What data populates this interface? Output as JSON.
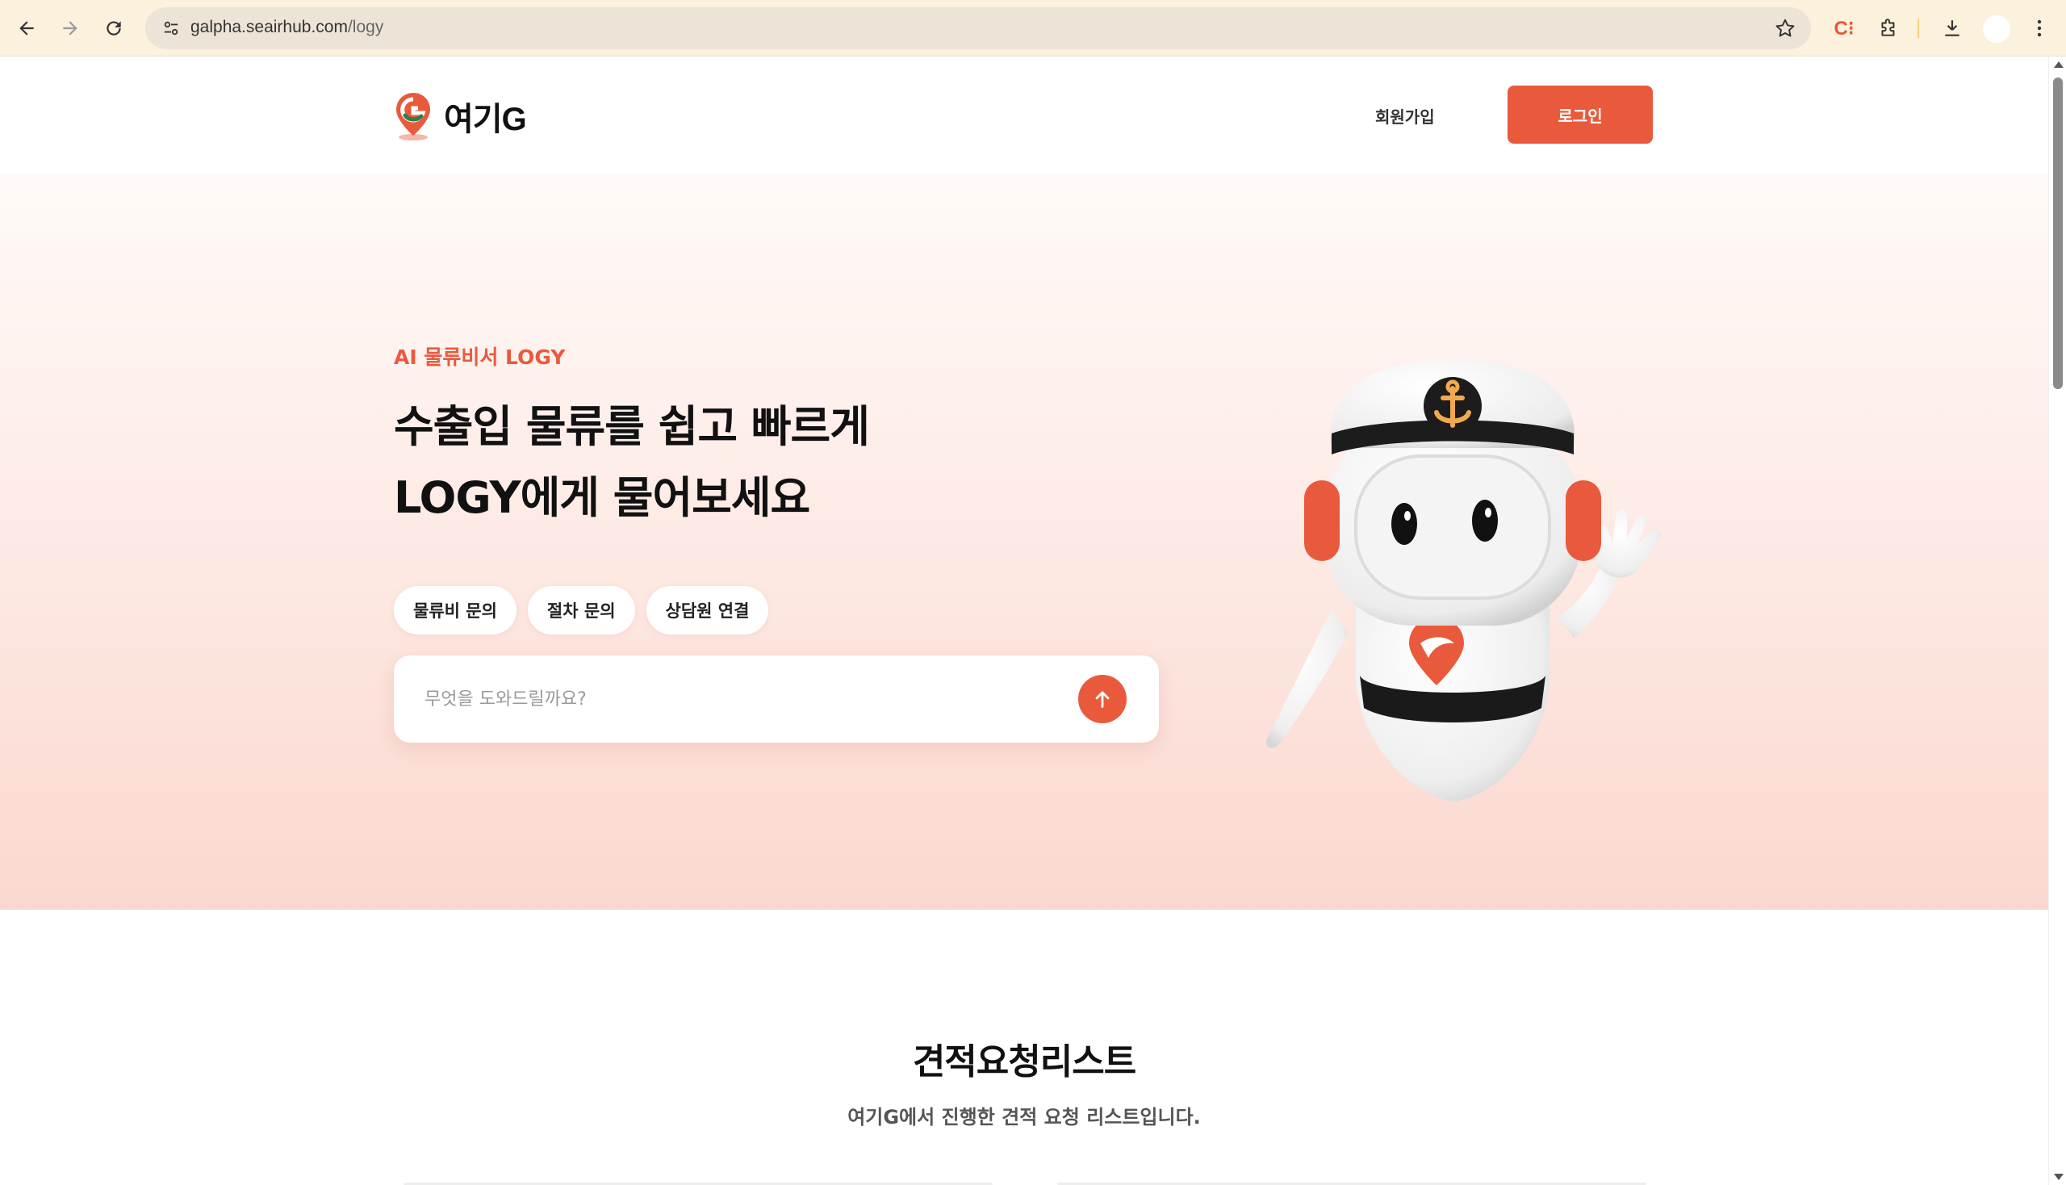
{
  "browser": {
    "url_host": "galpha.seairhub.com",
    "url_path": "/logy",
    "extension_badge": "C⁝"
  },
  "header": {
    "logo_text": "여기G",
    "signup_label": "회원가입",
    "login_label": "로그인"
  },
  "hero": {
    "eyebrow": "AI 물류비서 LOGY",
    "title_line1": "수출입 물류를 쉽고 빠르게",
    "title_line2": "LOGY에게 물어보세요",
    "chips": [
      "물류비 문의",
      "절차 문의",
      "상담원 연결"
    ],
    "search_placeholder": "무엇을 도와드릴까요?"
  },
  "quote_section": {
    "title": "견적요청리스트",
    "subtitle": "여기G에서 진행한 견적 요청 리스트입니다."
  },
  "colors": {
    "accent": "#e95a3c",
    "hero_top": "#fffaf8",
    "hero_bottom": "#fbd8cf",
    "logo_green": "#2e7d4a"
  },
  "icons": {
    "back": "arrow-left-icon",
    "forward": "arrow-right-icon",
    "reload": "reload-icon",
    "site_info": "tune-icon",
    "bookmark": "star-icon",
    "extensions": "puzzle-icon",
    "download": "download-icon",
    "menu": "kebab-menu-icon",
    "send": "arrow-up-icon",
    "logo": "location-pin-g-icon"
  }
}
